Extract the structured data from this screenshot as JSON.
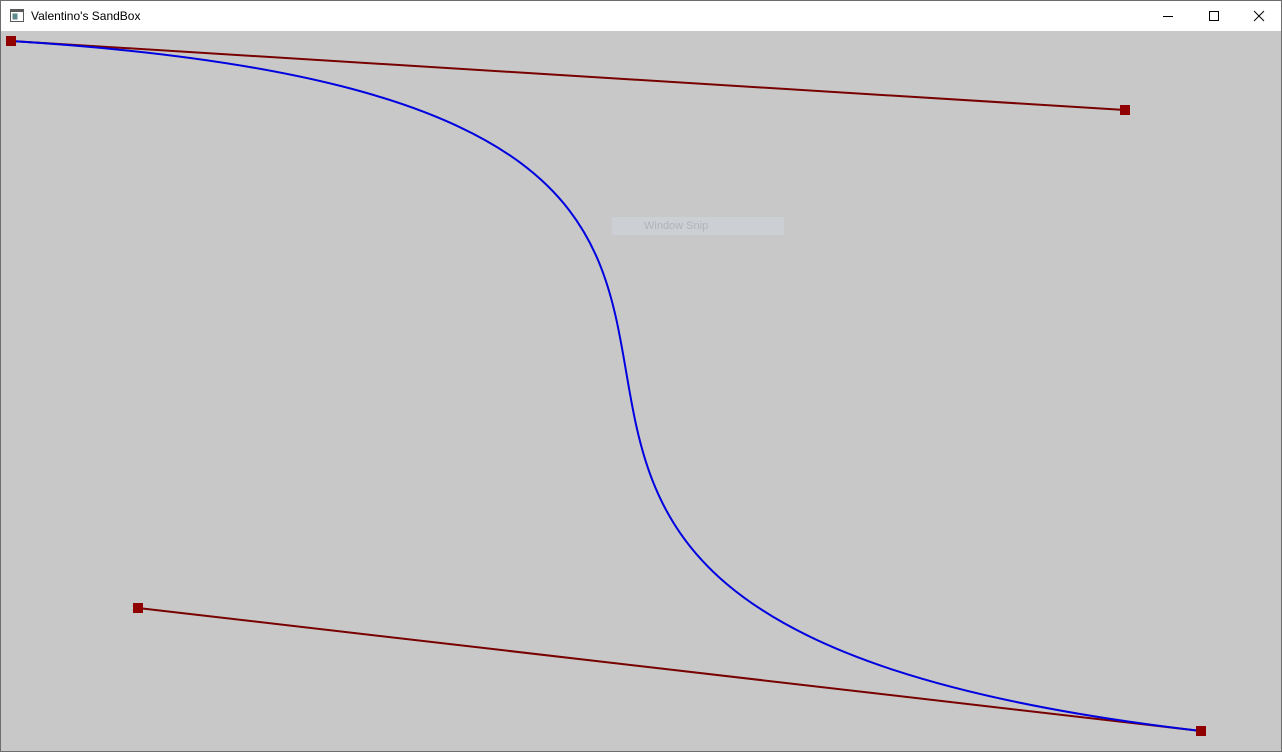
{
  "window": {
    "title": "Valentino's SandBox",
    "app_icon": "window-app-icon",
    "buttons": [
      {
        "name": "minimize",
        "icon": "minimize-icon"
      },
      {
        "name": "maximize",
        "icon": "maximize-icon"
      },
      {
        "name": "close",
        "icon": "close-icon"
      }
    ]
  },
  "canvas": {
    "background_color": "#c8c8c8",
    "curve_color": "#0000e0",
    "handle_line_color": "#780000",
    "control_point_color": "#900000"
  },
  "overlay": {
    "snip_label": "Window Snip"
  }
}
